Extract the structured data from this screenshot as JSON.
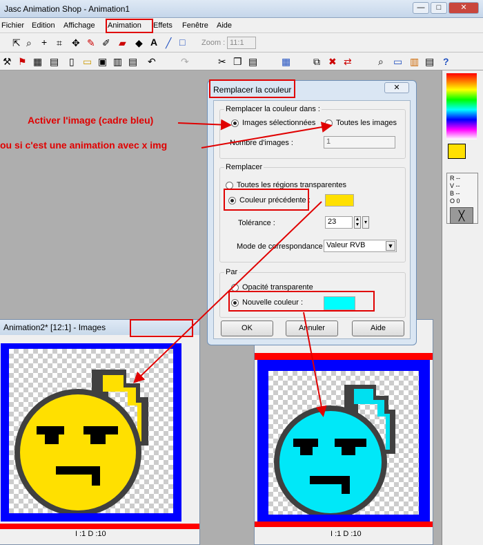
{
  "app": {
    "title": "Jasc Animation Shop - Animation1",
    "minimize": "—",
    "maximize": "□",
    "close": "✕"
  },
  "menu": [
    "Fichier",
    "Edition",
    "Affichage",
    "Animation",
    "Effets",
    "Fenêtre",
    "Aide"
  ],
  "toolbar": {
    "zoom_label": "Zoom :",
    "zoom_value": "11:1"
  },
  "dialog": {
    "title": "Remplacer la couleur",
    "close": "✕",
    "group1_title": "Remplacer la couleur dans :",
    "opt_selected": "Images sélectionnées",
    "opt_all": "Toutes les images",
    "frames_label": "Nombre d'images :",
    "frames_value": "1",
    "group2_title": "Remplacer",
    "opt_transparent_regions": "Toutes les régions transparentes",
    "opt_prev_color": "Couleur précédente :",
    "tolerance_label": "Tolérance :",
    "tolerance_value": "23",
    "match_label": "Mode de correspondance :",
    "match_value": "Valeur RVB",
    "group3_title": "Par",
    "opt_opacity": "Opacité transparente",
    "opt_new_color": "Nouvelle couleur :",
    "ok": "OK",
    "cancel": "Annuler",
    "help": "Aide",
    "prev_color": "#ffe000",
    "new_color": "#00ffff"
  },
  "annotations": {
    "line1": "Activer l'image (cadre bleu)",
    "line2": "ou si c'est une animation avec  x img"
  },
  "panel": {
    "r": "R --",
    "v": "V --",
    "b": "B --",
    "o": "O 0"
  },
  "window_left": {
    "title": "Animation2* [12:1] - Images",
    "status": "I :1   D :10"
  },
  "window_right": {
    "status": "I :1   D :10"
  },
  "colors": {
    "accent_red": "#e00000",
    "yellow": "#ffe000",
    "cyan": "#00ffff",
    "frame_blue": "#0000ff"
  }
}
